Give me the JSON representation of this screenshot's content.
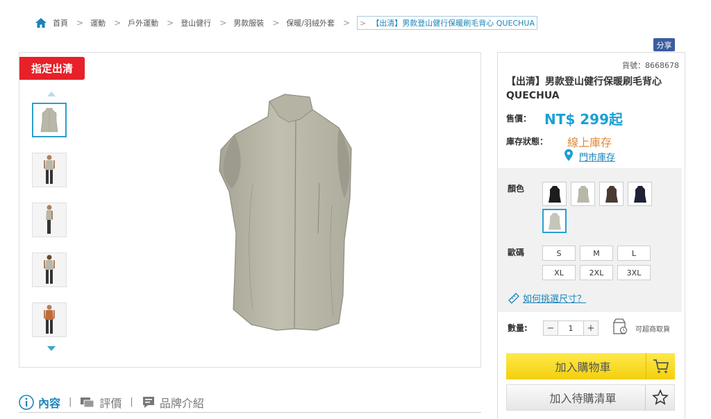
{
  "breadcrumb": {
    "items": [
      "首頁",
      "運動",
      "戶外運動",
      "登山健行",
      "男款服裝",
      "保暖/羽絨外套"
    ],
    "current": "【出清】男款登山健行保暖刷毛背心 QUECHUA"
  },
  "share_label": "分享",
  "gallery": {
    "badge": "指定出清",
    "thumbnails": [
      "vest-front",
      "model-front",
      "model-side",
      "model-back",
      "model-front-2"
    ],
    "active_index": 0
  },
  "product": {
    "sku": "貨號：8668678",
    "title": "【出清】男款登山健行保暖刷毛背心 QUECHUA",
    "price_label": "售價：",
    "price": "NT$ 299起",
    "stock_label": "庫存狀態：",
    "stock_online": "線上庫存",
    "store_stock": "門市庫存"
  },
  "options": {
    "color_label": "顏色",
    "colors": [
      "#1d1d1d",
      "#b9b7a8",
      "#4a3a33",
      "#1e2235",
      "#c4c6b8"
    ],
    "selected_color_index": 4,
    "size_label": "歐碼",
    "sizes": [
      "S",
      "M",
      "L",
      "XL",
      "2XL",
      "3XL"
    ],
    "size_guide": "如何挑選尺寸？"
  },
  "quantity": {
    "label": "數量:",
    "minus": "−",
    "value": "1",
    "plus": "+",
    "pickup": "可超商取貨"
  },
  "actions": {
    "add_to_cart": "加入購物車",
    "add_to_wishlist": "加入待購清單"
  },
  "tabs": [
    "內容",
    "評價",
    "品牌介紹"
  ],
  "colors": {
    "accent": "#1a9fd6",
    "badge": "#e62129",
    "cart": "#f3cf0d",
    "stock": "#e08a3a",
    "share": "#3c5d9e"
  }
}
